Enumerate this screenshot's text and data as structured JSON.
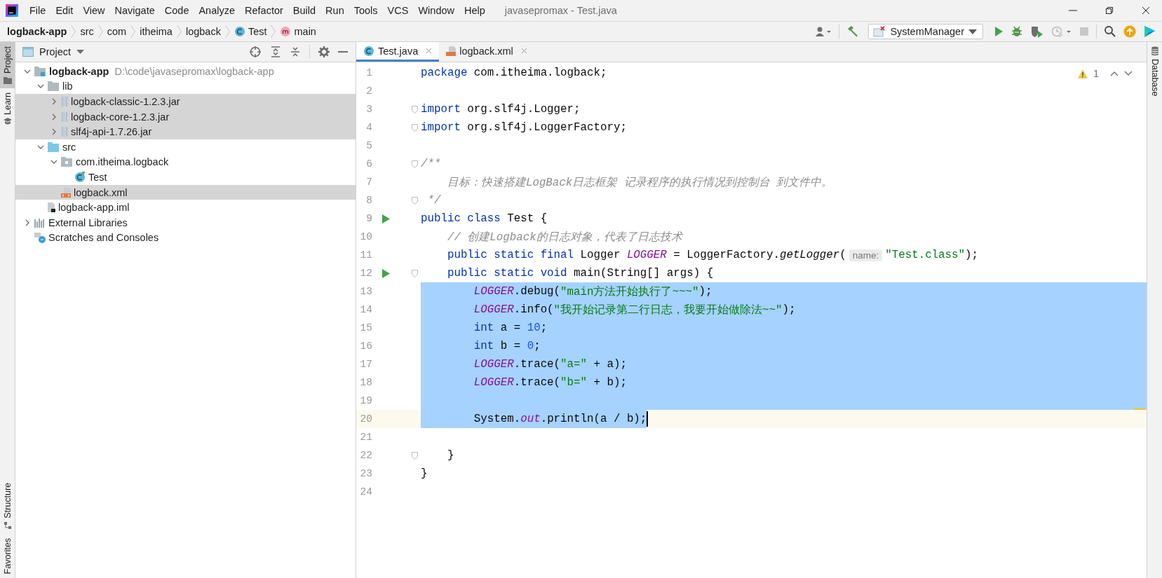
{
  "window": {
    "title": "javasepromax - Test.java"
  },
  "menu": [
    "File",
    "Edit",
    "View",
    "Navigate",
    "Code",
    "Analyze",
    "Refactor",
    "Build",
    "Run",
    "Tools",
    "VCS",
    "Window",
    "Help"
  ],
  "breadcrumbs": [
    {
      "label": "logback-app",
      "kind": "project"
    },
    {
      "label": "src",
      "kind": "folder"
    },
    {
      "label": "com",
      "kind": "folder"
    },
    {
      "label": "itheima",
      "kind": "folder"
    },
    {
      "label": "logback",
      "kind": "folder"
    },
    {
      "label": "Test",
      "kind": "class"
    },
    {
      "label": "main",
      "kind": "method"
    }
  ],
  "toolbar": {
    "run_config": "SystemManager"
  },
  "left_tabs": [
    {
      "label": "Project",
      "selected": true
    },
    {
      "label": "Learn",
      "selected": false
    }
  ],
  "left_bottom_tabs": [
    "Structure",
    "Favorites"
  ],
  "right_tabs": [
    "Database"
  ],
  "project_panel": {
    "title": "Project",
    "tree": [
      {
        "label": "logback-app",
        "kind": "project",
        "path": "D:\\code\\javasepromax\\logback-app",
        "expanded": true,
        "selected": false,
        "children": [
          {
            "label": "lib",
            "kind": "folder",
            "expanded": true,
            "selected": false,
            "children": [
              {
                "label": "logback-classic-1.2.3.jar",
                "kind": "jar",
                "expanded": false,
                "selected": true
              },
              {
                "label": "logback-core-1.2.3.jar",
                "kind": "jar",
                "expanded": false,
                "selected": true
              },
              {
                "label": "slf4j-api-1.7.26.jar",
                "kind": "jar",
                "expanded": false,
                "selected": true
              }
            ]
          },
          {
            "label": "src",
            "kind": "source",
            "expanded": true,
            "selected": false,
            "children": [
              {
                "label": "com.itheima.logback",
                "kind": "package",
                "expanded": true,
                "selected": false,
                "children": [
                  {
                    "label": "Test",
                    "kind": "class",
                    "selected": false
                  }
                ]
              },
              {
                "label": "logback.xml",
                "kind": "xml",
                "selected": true
              }
            ]
          },
          {
            "label": "logback-app.iml",
            "kind": "iml",
            "selected": false
          }
        ]
      },
      {
        "label": "External Libraries",
        "kind": "libraries",
        "expanded": false,
        "selected": false
      },
      {
        "label": "Scratches and Consoles",
        "kind": "scratches",
        "selected": false
      }
    ]
  },
  "editor": {
    "tabs": [
      {
        "label": "Test.java",
        "kind": "class",
        "selected": true
      },
      {
        "label": "logback.xml",
        "kind": "xml",
        "selected": false
      }
    ],
    "warnings": "1",
    "lines": [
      {
        "number": "1",
        "selected": false,
        "current": false,
        "tokens": [
          {
            "kind": "kw",
            "text": "package "
          },
          {
            "kind": "pl",
            "text": "com.itheima.logback;"
          }
        ]
      },
      {
        "number": "2",
        "selected": false,
        "current": false
      },
      {
        "number": "3",
        "selected": false,
        "current": false,
        "fold": true,
        "tokens": [
          {
            "kind": "kw",
            "text": "import "
          },
          {
            "kind": "pl",
            "text": "org.slf4j.Logger;"
          }
        ]
      },
      {
        "number": "4",
        "selected": false,
        "current": false,
        "fold": true,
        "tokens": [
          {
            "kind": "kw",
            "text": "import "
          },
          {
            "kind": "pl",
            "text": "org.slf4j.LoggerFactory;"
          }
        ]
      },
      {
        "number": "5",
        "selected": false,
        "current": false
      },
      {
        "number": "6",
        "selected": false,
        "current": false,
        "fold": true,
        "tokens": [
          {
            "kind": "cm",
            "text": "/**"
          }
        ]
      },
      {
        "number": "7",
        "selected": false,
        "current": false,
        "tokens": [
          {
            "kind": "cm",
            "text": "    目标：快速搭建LogBack日志框架 记录程序的执行情况到控制台 到文件中。"
          }
        ]
      },
      {
        "number": "8",
        "selected": false,
        "current": false,
        "fold": true,
        "tokens": [
          {
            "kind": "cm",
            "text": " */"
          }
        ]
      },
      {
        "number": "9",
        "selected": false,
        "current": false,
        "run": true,
        "tokens": [
          {
            "kind": "kw",
            "text": "public class "
          },
          {
            "kind": "pl",
            "text": "Test {"
          }
        ]
      },
      {
        "number": "10",
        "selected": false,
        "current": false,
        "tokens": [
          {
            "kind": "cm",
            "text": "    // 创建Logback的日志对象，代表了日志技术"
          }
        ]
      },
      {
        "number": "11",
        "selected": false,
        "current": false,
        "tokens": [
          {
            "kind": "kw",
            "text": "    public static final "
          },
          {
            "kind": "pl",
            "text": "Logger "
          },
          {
            "kind": "fd",
            "text": "LOGGER"
          },
          {
            "kind": "pl",
            "text": " = LoggerFactory."
          },
          {
            "kind": "mi",
            "text": "getLogger"
          },
          {
            "kind": "pl",
            "text": "("
          },
          {
            "kind": "hint",
            "text": "name:"
          },
          {
            "kind": "str",
            "text": "\"Test.class\""
          },
          {
            "kind": "pl",
            "text": ");"
          }
        ]
      },
      {
        "number": "12",
        "selected": false,
        "current": false,
        "run": true,
        "fold": true,
        "tokens": [
          {
            "kind": "kw",
            "text": "    public static void "
          },
          {
            "kind": "pl",
            "text": "main(String[] args) {"
          }
        ]
      },
      {
        "number": "13",
        "selected": true,
        "current": false,
        "tokens": [
          {
            "kind": "fd",
            "text": "        LOGGER"
          },
          {
            "kind": "pl",
            "text": ".debug("
          },
          {
            "kind": "str",
            "text": "\"main方法开始执行了~~~\""
          },
          {
            "kind": "pl",
            "text": ");"
          }
        ]
      },
      {
        "number": "14",
        "selected": true,
        "current": false,
        "tokens": [
          {
            "kind": "fd",
            "text": "        LOGGER"
          },
          {
            "kind": "pl",
            "text": ".info("
          },
          {
            "kind": "str",
            "text": "\"我开始记录第二行日志，我要开始做除法~~\""
          },
          {
            "kind": "pl",
            "text": ");"
          }
        ]
      },
      {
        "number": "15",
        "selected": true,
        "current": false,
        "tokens": [
          {
            "kind": "kw",
            "text": "        int "
          },
          {
            "kind": "pl",
            "text": "a = "
          },
          {
            "kind": "num",
            "text": "10"
          },
          {
            "kind": "pl",
            "text": ";"
          }
        ]
      },
      {
        "number": "16",
        "selected": true,
        "current": false,
        "tokens": [
          {
            "kind": "kw",
            "text": "        int "
          },
          {
            "kind": "pl",
            "text": "b = "
          },
          {
            "kind": "num",
            "text": "0"
          },
          {
            "kind": "pl",
            "text": ";"
          }
        ]
      },
      {
        "number": "17",
        "selected": true,
        "current": false,
        "tokens": [
          {
            "kind": "fd",
            "text": "        LOGGER"
          },
          {
            "kind": "pl",
            "text": ".trace("
          },
          {
            "kind": "str",
            "text": "\"a=\""
          },
          {
            "kind": "pl",
            "text": " + a);"
          }
        ]
      },
      {
        "number": "18",
        "selected": true,
        "current": false,
        "tokens": [
          {
            "kind": "fd",
            "text": "        LOGGER"
          },
          {
            "kind": "pl",
            "text": ".trace("
          },
          {
            "kind": "str",
            "text": "\"b=\""
          },
          {
            "kind": "pl",
            "text": " + b);"
          }
        ]
      },
      {
        "number": "19",
        "selected": true,
        "current": false
      },
      {
        "number": "20",
        "selected": true,
        "current": true,
        "tokens": [
          {
            "kind": "pl",
            "text": "        System."
          },
          {
            "kind": "fd",
            "text": "out"
          },
          {
            "kind": "pl",
            "text": ".println(a / b);"
          }
        ]
      },
      {
        "number": "21",
        "selected": false,
        "current": false
      },
      {
        "number": "22",
        "selected": false,
        "current": false,
        "fold": true,
        "tokens": [
          {
            "kind": "pl",
            "text": "    }"
          }
        ]
      },
      {
        "number": "23",
        "selected": false,
        "current": false,
        "tokens": [
          {
            "kind": "pl",
            "text": "}"
          }
        ]
      },
      {
        "number": "24",
        "selected": false,
        "current": false
      }
    ]
  }
}
